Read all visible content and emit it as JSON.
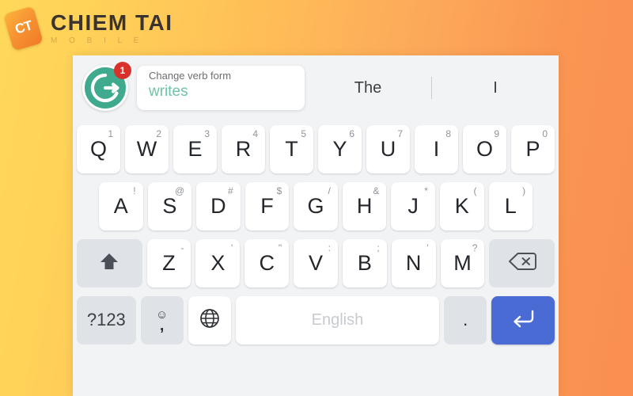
{
  "brand": {
    "logo_icon": "ct-phone-logo-icon",
    "mark_text": "CT",
    "name": "CHIEM TAI",
    "subtitle": "M O B I L E"
  },
  "keyboard": {
    "suggestion_bar": {
      "grammarly_icon": "grammarly-g-icon",
      "badge_count": "1",
      "card": {
        "title": "Change verb form",
        "word": "writes"
      },
      "word_suggestions": [
        "The",
        "I"
      ]
    },
    "rows": {
      "row1": [
        {
          "glyph": "Q",
          "sup": "1",
          "name": "key-q"
        },
        {
          "glyph": "W",
          "sup": "2",
          "name": "key-w"
        },
        {
          "glyph": "E",
          "sup": "3",
          "name": "key-e"
        },
        {
          "glyph": "R",
          "sup": "4",
          "name": "key-r"
        },
        {
          "glyph": "T",
          "sup": "5",
          "name": "key-t"
        },
        {
          "glyph": "Y",
          "sup": "6",
          "name": "key-y"
        },
        {
          "glyph": "U",
          "sup": "7",
          "name": "key-u"
        },
        {
          "glyph": "I",
          "sup": "8",
          "name": "key-i"
        },
        {
          "glyph": "O",
          "sup": "9",
          "name": "key-o"
        },
        {
          "glyph": "P",
          "sup": "0",
          "name": "key-p"
        }
      ],
      "row2": [
        {
          "glyph": "A",
          "sup": "!",
          "name": "key-a"
        },
        {
          "glyph": "S",
          "sup": "@",
          "name": "key-s"
        },
        {
          "glyph": "D",
          "sup": "#",
          "name": "key-d"
        },
        {
          "glyph": "F",
          "sup": "$",
          "name": "key-f"
        },
        {
          "glyph": "G",
          "sup": "/",
          "name": "key-g"
        },
        {
          "glyph": "H",
          "sup": "&",
          "name": "key-h"
        },
        {
          "glyph": "J",
          "sup": "*",
          "name": "key-j"
        },
        {
          "glyph": "K",
          "sup": "(",
          "name": "key-k"
        },
        {
          "glyph": "L",
          "sup": ")",
          "name": "key-l"
        }
      ],
      "row3": [
        {
          "glyph": "Z",
          "sup": "-",
          "name": "key-z"
        },
        {
          "glyph": "X",
          "sup": "'",
          "name": "key-x"
        },
        {
          "glyph": "C",
          "sup": "\"",
          "name": "key-c"
        },
        {
          "glyph": "V",
          "sup": ":",
          "name": "key-v"
        },
        {
          "glyph": "B",
          "sup": ";",
          "name": "key-b"
        },
        {
          "glyph": "N",
          "sup": "'",
          "name": "key-n"
        },
        {
          "glyph": "M",
          "sup": "?",
          "name": "key-m"
        }
      ]
    },
    "shift_icon": "shift-arrow-up-icon",
    "backspace_icon": "backspace-icon",
    "numbers_key_label": "?123",
    "emoji_icon": "emoji-smiley-icon",
    "comma_label": ",",
    "globe_icon": "globe-language-icon",
    "space_label": "English",
    "period_label": ".",
    "enter_icon": "enter-return-icon"
  },
  "colors": {
    "bg_gradient_start": "#ffd85a",
    "bg_gradient_end": "#f98f50",
    "keyboard_bg": "#f2f3f5",
    "key_bg": "#ffffff",
    "fn_key_bg": "#dfe2e7",
    "enter_blue": "#4a6ad4",
    "grammarly_green": "#3faa8d",
    "suggestion_word_green": "#6fc3a6",
    "badge_red": "#d9302c"
  }
}
